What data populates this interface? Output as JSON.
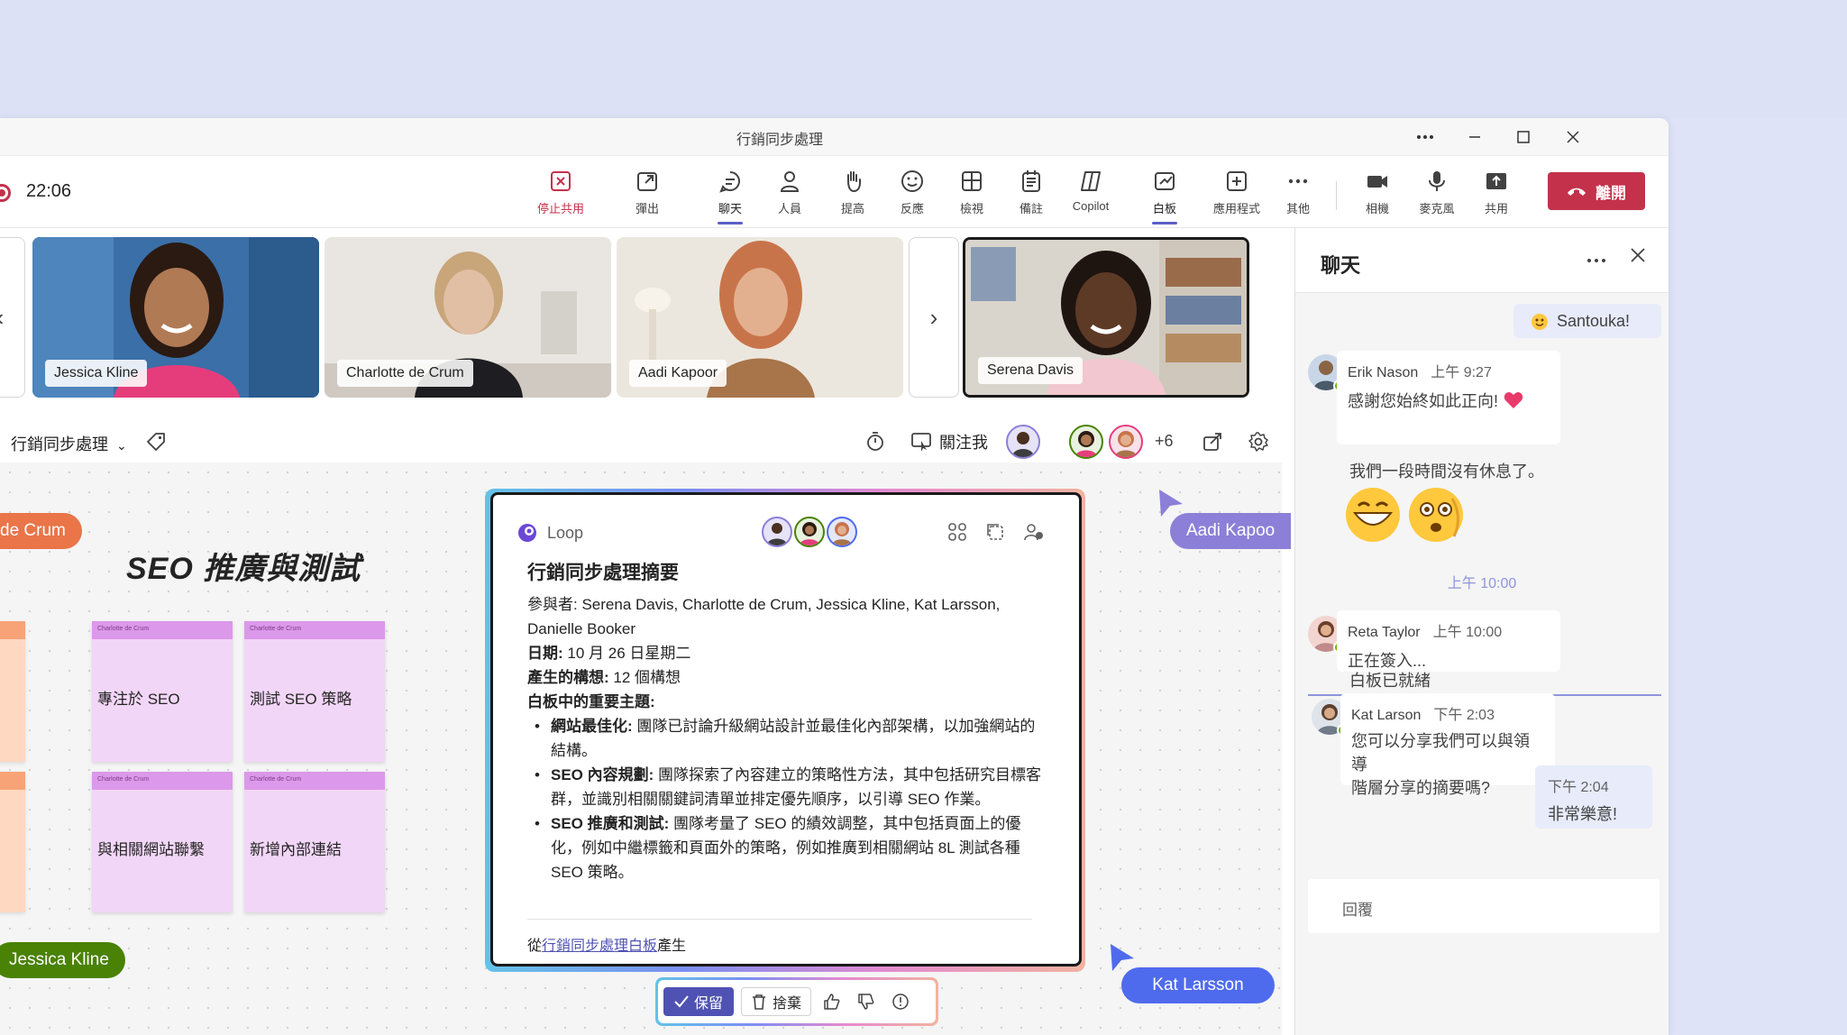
{
  "window": {
    "title": "行銷同步處理"
  },
  "toolbar": {
    "timer": "22:06",
    "buttons": [
      {
        "label": "停止共用",
        "icon": "stop-share-icon"
      },
      {
        "label": "彈出",
        "icon": "pop-out-icon"
      },
      {
        "label": "聊天",
        "icon": "chat-icon"
      },
      {
        "label": "人員",
        "icon": "people-icon"
      },
      {
        "label": "提高",
        "icon": "raise-hand-icon"
      },
      {
        "label": "反應",
        "icon": "reactions-icon"
      },
      {
        "label": "檢視",
        "icon": "view-icon"
      },
      {
        "label": "備註",
        "icon": "notes-icon"
      },
      {
        "label": "Copilot",
        "icon": "copilot-icon"
      },
      {
        "label": "白板",
        "icon": "whiteboard-icon"
      },
      {
        "label": "應用程式",
        "icon": "apps-icon"
      },
      {
        "label": "其他",
        "icon": "more-icon"
      },
      {
        "label": "相機",
        "icon": "camera-icon"
      },
      {
        "label": "麥克風",
        "icon": "mic-icon"
      },
      {
        "label": "共用",
        "icon": "share-icon"
      }
    ],
    "leave_label": "離開"
  },
  "participants": [
    {
      "name": "Jessica Kline",
      "skin": "#b07a55",
      "bg": "#3a6fa8",
      "shirt": "#e53d7c"
    },
    {
      "name": "Charlotte de Crum",
      "skin": "#e0bfa5",
      "bg": "#e9e6e1",
      "shirt": "#1e1e22"
    },
    {
      "name": "Aadi Kapoor",
      "skin": "#e3b08f",
      "bg": "#ece7de",
      "shirt": "#a8744a"
    },
    {
      "name": "Serena Davis",
      "skin": "#5d3a26",
      "bg": "#d9d4cc",
      "shirt": "#f2c7cf"
    }
  ],
  "whiteboard_header": {
    "title": "行銷同步處理",
    "follow_label": "關注我",
    "extra_count": "+6"
  },
  "canvas": {
    "heading": "SEO 推廣與測試",
    "stickies": [
      {
        "author": "Charlotte de Crum",
        "text": "專注於 SEO"
      },
      {
        "author": "Charlotte de Crum",
        "text": "測試 SEO 策略"
      },
      {
        "author": "Charlotte de Crum",
        "text": "與相關網站聯繫"
      },
      {
        "author": "Charlotte de Crum",
        "text": "新增內部連結"
      }
    ],
    "cursors": [
      {
        "name": "de Crum",
        "color": "#e97548"
      },
      {
        "name": "Aadi Kapoo",
        "color": "#8b7fd8"
      },
      {
        "name": "Jessica Kline",
        "color": "#498205"
      },
      {
        "name": "Kat Larsson",
        "color": "#4f6bed"
      }
    ]
  },
  "loop": {
    "app_name": "Loop",
    "title": "行銷同步處理摘要",
    "attendees_label": "參與者: ",
    "attendees": "Serena Davis, Charlotte de Crum, Jessica Kline, Kat Larsson, Danielle Booker",
    "date_label": "日期: ",
    "date": "10 月 26 日星期二",
    "ideas_label": "產生的構想: ",
    "ideas": "12 個構想",
    "topics_label": "白板中的重要主題:",
    "topics": [
      {
        "head": "網站最佳化: ",
        "text": "團隊已討論升級網站設計並最佳化內部架構，以加強網站的結構。"
      },
      {
        "head": "SEO 內容規劃: ",
        "text": "團隊探索了內容建立的策略性方法，其中包括研究目標客群，並識別相關關鍵詞清單並排定優先順序，以引導 SEO 作業。"
      },
      {
        "head": "SEO 推廣和測試: ",
        "text": "團隊考量了 SEO 的績效調整，其中包括頁面上的優化，例如中繼標籤和頁面外的策略，例如推廣到相關網站 8L 測試各種 SEO 策略。"
      }
    ],
    "footer_prefix": "從",
    "footer_link": "行銷同步處理白板",
    "footer_suffix": "產生"
  },
  "action_bar": {
    "keep_label": "保留",
    "discard_label": "捨棄"
  },
  "chat": {
    "title": "聊天",
    "top_bubble": "Santouka!",
    "messages": [
      {
        "name": "Erik Nason",
        "time": "上午 9:27",
        "lines": [
          "感謝您始終如此正向!",
          "我們一段時間沒有休息了。"
        ]
      },
      {
        "name": "Reta Taylor",
        "time": "上午 10:00",
        "lines": [
          "正在簽入...",
          "白板已就緒"
        ]
      },
      {
        "name": "Kat Larson",
        "time": "下午 2:03",
        "lines": [
          "您可以分享我們可以與領導",
          "階層分享的摘要嗎?"
        ]
      }
    ],
    "divider": "上午 10:00",
    "mine": {
      "time": "下午 2:04",
      "text": "非常樂意!"
    },
    "reply_placeholder": "回覆"
  }
}
